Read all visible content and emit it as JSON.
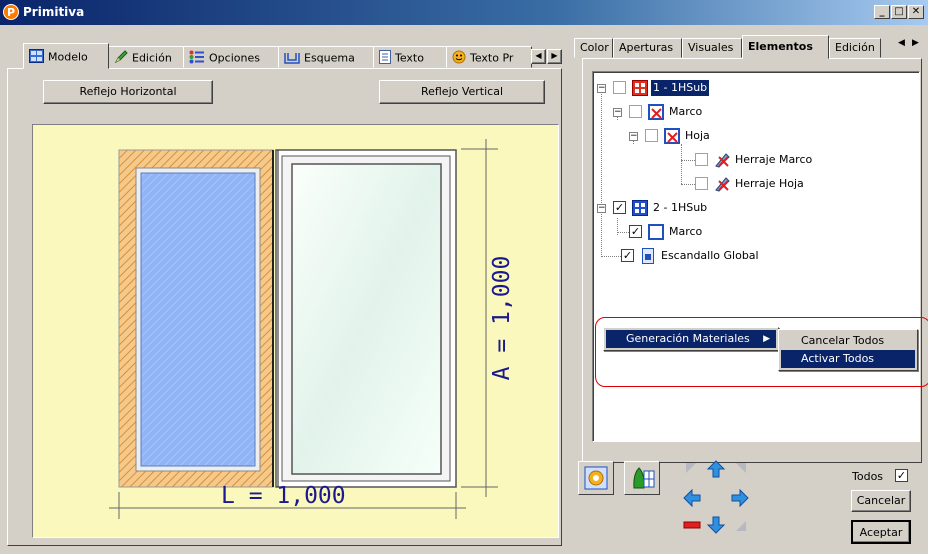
{
  "window": {
    "title": "Primitiva",
    "app_icon_letter": "P"
  },
  "left_tabs": [
    {
      "label": "Modelo"
    },
    {
      "label": "Edición"
    },
    {
      "label": "Opciones"
    },
    {
      "label": "Esquema"
    },
    {
      "label": "Texto"
    },
    {
      "label": "Texto Pr"
    }
  ],
  "buttons": {
    "reflejo_horizontal": "Reflejo Horizontal",
    "reflejo_vertical": "Reflejo Vertical"
  },
  "drawing": {
    "width_label": "L = 1,000",
    "height_label": "A = 1,000"
  },
  "right_tabs": [
    {
      "label": "Color"
    },
    {
      "label": "Aperturas"
    },
    {
      "label": "Visuales"
    },
    {
      "label": "Elementos"
    },
    {
      "label": "Edición"
    }
  ],
  "tree": [
    {
      "label": "1 - 1HSub",
      "checked": false,
      "selected": true
    },
    {
      "label": "Marco",
      "checked": false
    },
    {
      "label": "Hoja",
      "checked": false
    },
    {
      "label": "Herraje Marco",
      "checked": false
    },
    {
      "label": "Herraje Hoja",
      "checked": false
    },
    {
      "label": "2 - 1HSub",
      "checked": true
    },
    {
      "label": "Marco",
      "checked": true
    },
    {
      "label": "Escandallo Global",
      "checked": true
    }
  ],
  "context_menu": {
    "item": "Generación Materiales",
    "submenu": [
      "Cancelar Todos",
      "Activar Todos"
    ]
  },
  "footer": {
    "todos_label": "Todos",
    "todos_checked": true,
    "cancel_label": "Cancelar",
    "accept_label": "Aceptar"
  }
}
